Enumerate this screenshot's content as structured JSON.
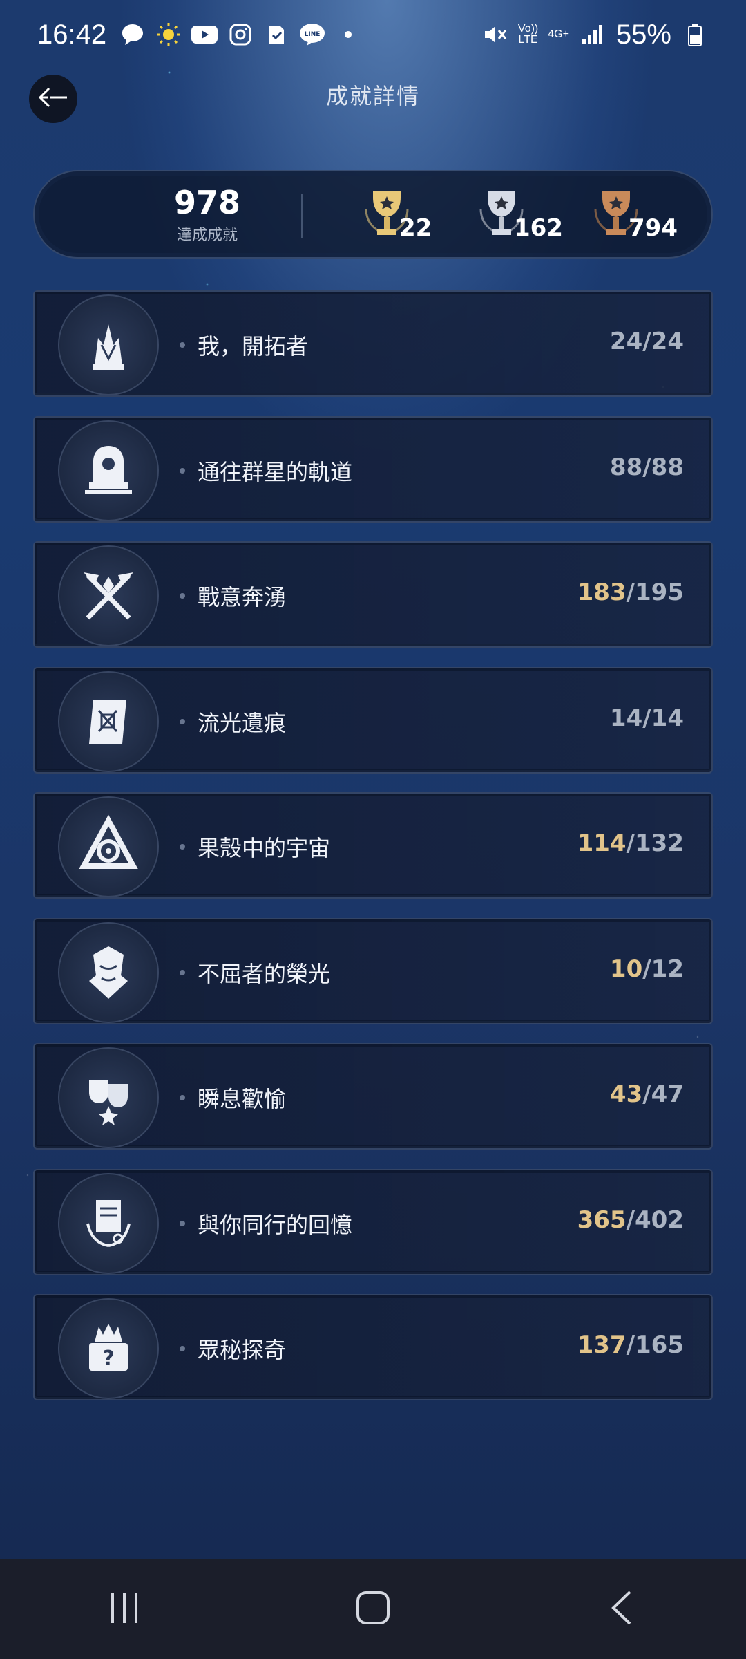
{
  "status_bar": {
    "time": "16:42",
    "network": "4G+",
    "volte": "Vo))\nLTE",
    "battery": "55%",
    "notification_icons": [
      "chat-icon",
      "sun-icon",
      "youtube-icon",
      "instagram-icon",
      "note-icon",
      "line-icon",
      "dot-icon"
    ]
  },
  "header": {
    "title": "成就詳情"
  },
  "summary": {
    "total": "978",
    "total_label": "達成成就",
    "gold": "22",
    "silver": "162",
    "bronze": "794"
  },
  "categories": [
    {
      "title": "我，開拓者",
      "done": "24",
      "total": "24",
      "complete": true,
      "icon": "pioneer-icon"
    },
    {
      "title": "通往群星的軌道",
      "done": "88",
      "total": "88",
      "complete": true,
      "icon": "stars-orbit-icon"
    },
    {
      "title": "戰意奔湧",
      "done": "183",
      "total": "195",
      "complete": false,
      "icon": "crossed-axes-icon"
    },
    {
      "title": "流光遺痕",
      "done": "14",
      "total": "14",
      "complete": true,
      "icon": "scroll-icon"
    },
    {
      "title": "果殼中的宇宙",
      "done": "114",
      "total": "132",
      "complete": false,
      "icon": "triangle-knot-icon"
    },
    {
      "title": "不屈者的榮光",
      "done": "10",
      "total": "12",
      "complete": false,
      "icon": "crest-icon"
    },
    {
      "title": "瞬息歡愉",
      "done": "43",
      "total": "47",
      "complete": false,
      "icon": "masks-icon"
    },
    {
      "title": "與你同行的回憶",
      "done": "365",
      "total": "402",
      "complete": false,
      "icon": "memory-book-icon"
    },
    {
      "title": "眾秘探奇",
      "done": "137",
      "total": "165",
      "complete": false,
      "icon": "mystery-chest-icon"
    }
  ],
  "colors": {
    "gold_trophy": "#e8c878",
    "silver_trophy": "#d6dbe6",
    "bronze_trophy": "#c98a5a",
    "progress_highlight": "#e2c48a",
    "progress_complete": "#aab3c2"
  }
}
